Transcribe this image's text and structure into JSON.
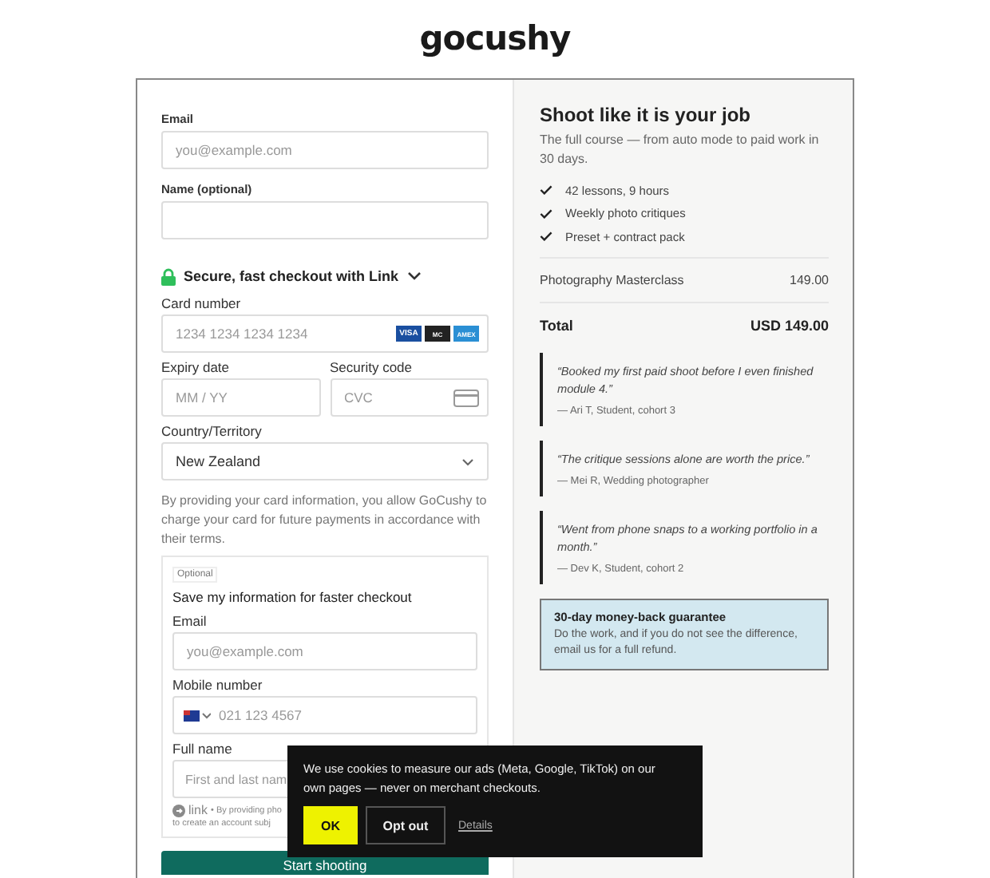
{
  "logo": "gocushy",
  "checkout": {
    "email": {
      "label": "Email",
      "placeholder": "you@example.com"
    },
    "name": {
      "label": "Name (optional)"
    },
    "link_row": {
      "label": "Secure, fast checkout with Link"
    },
    "card_number": {
      "label": "Card number",
      "placeholder": "1234 1234 1234 1234",
      "brands": [
        "VISA",
        "MC",
        "AMEX"
      ]
    },
    "expiry": {
      "label": "Expiry date",
      "placeholder": "MM / YY"
    },
    "security": {
      "label": "Security code",
      "placeholder": "CVC"
    },
    "country": {
      "label": "Country/Territory",
      "value": "New Zealand"
    },
    "terms": "By providing your card information, you allow GoCushy to charge your card for future payments in accordance with their terms.",
    "save": {
      "tag": "Optional",
      "title": "Save my information for faster checkout",
      "email": {
        "label": "Email",
        "placeholder": "you@example.com"
      },
      "mobile": {
        "label": "Mobile number",
        "placeholder": "021 123 4567"
      },
      "full_name": {
        "label": "Full name",
        "placeholder": "First and last nam"
      },
      "link_brand": "link",
      "legal_lines": [
        "• By providing pho",
        "to create an account subj"
      ]
    },
    "submit": "Start shooting"
  },
  "summary": {
    "title": "Shoot like it is your job",
    "subtitle": "The full course — from auto mode to paid work in 30 days.",
    "features": [
      "42 lessons, 9 hours",
      "Weekly photo critiques",
      "Preset + contract pack"
    ],
    "line_item": {
      "name": "Photography Masterclass",
      "price": "149.00"
    },
    "total": {
      "label": "Total",
      "amount": "USD 149.00"
    },
    "testimonials": [
      {
        "quote": "“Booked my first paid shoot before I even finished module 4.”",
        "author": "— Ari T, Student, cohort 3"
      },
      {
        "quote": "“The critique sessions alone are worth the price.”",
        "author": "— Mei R, Wedding photographer"
      },
      {
        "quote": "“Went from phone snaps to a working portfolio in a month.”",
        "author": "— Dev K, Student, cohort 2"
      }
    ],
    "guarantee": {
      "title": "30-day money-back guarantee",
      "text": "Do the work, and if you do not see the difference, email us for a full refund."
    }
  },
  "cookie_banner": {
    "text": "We use cookies to measure our ads (Meta, Google, TikTok) on our own pages — never on merchant checkouts.",
    "ok": "OK",
    "opt_out": "Opt out",
    "details": "Details"
  }
}
